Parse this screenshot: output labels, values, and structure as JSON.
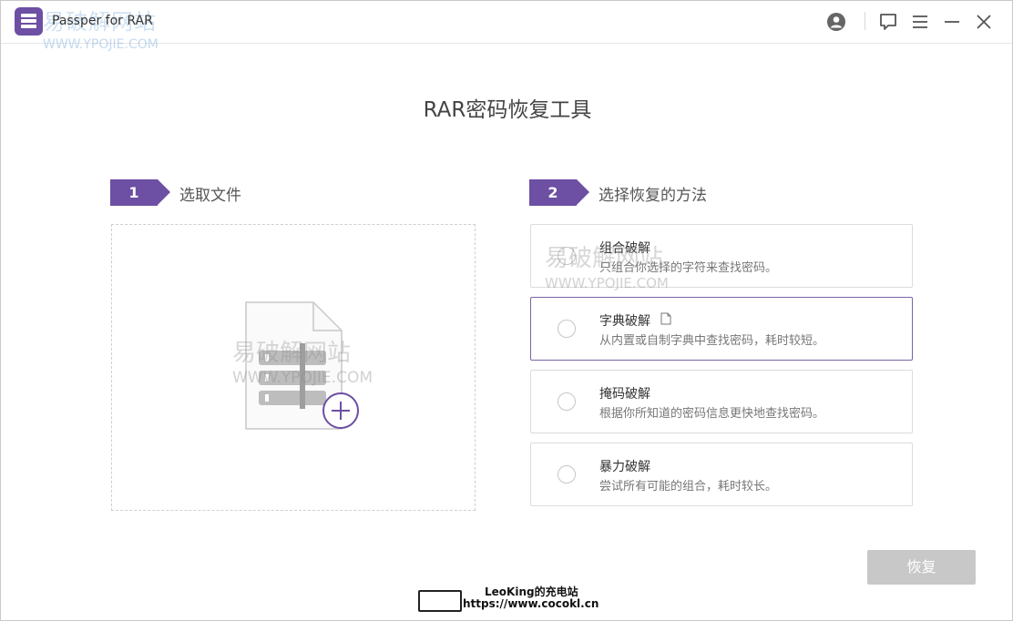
{
  "app": {
    "title": "Passper for RAR",
    "watermark_top": "易破解网站",
    "watermark_url": "WWW.YPOJIE.COM"
  },
  "toolbar": {
    "icons": [
      "account-icon",
      "feedback-icon",
      "menu-icon",
      "minimize-icon",
      "close-icon"
    ]
  },
  "main": {
    "heading": "RAR密码恢复工具",
    "step1": {
      "number": "1",
      "label": "选取文件"
    },
    "step2": {
      "number": "2",
      "label": "选择恢复的方法"
    },
    "dropzone": {
      "watermark": "易破解网站",
      "watermark_url": "WWW.YPOJIE.COM"
    },
    "methods": [
      {
        "title": "组合破解",
        "desc": "只组合你选择的字符来查找密码。",
        "watermark": "易破解网站",
        "watermark_url": "WWW.YPOJIE.COM"
      },
      {
        "title": "字典破解",
        "desc": "从内置或自制字典中查找密码，耗时较短。"
      },
      {
        "title": "掩码破解",
        "desc": "根据你所知道的密码信息更快地查找密码。"
      },
      {
        "title": "暴力破解",
        "desc": "尝试所有可能的组合，耗时较长。"
      }
    ],
    "selected_method": 1,
    "recover_label": "恢复"
  },
  "footer": {
    "line1": "LeoKing的充电站",
    "line2": "https://www.cocokl.cn"
  },
  "colors": {
    "accent": "#6d4fa3",
    "button_disabled": "#c8c8c8"
  }
}
